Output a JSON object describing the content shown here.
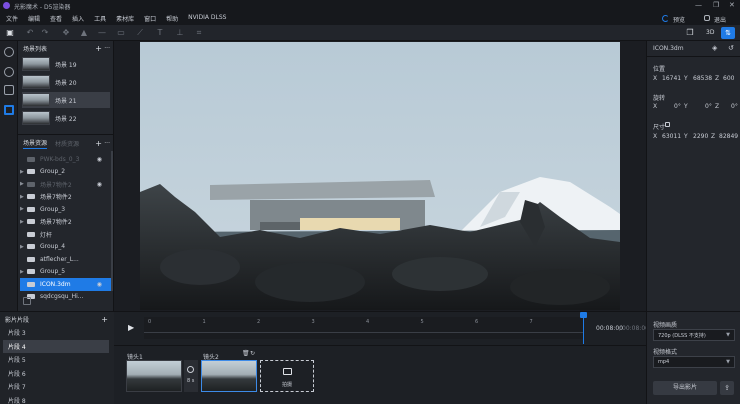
{
  "app": {
    "title": "光影魔术 - D5渲染器",
    "window_controls": [
      "—",
      "❐",
      "✕"
    ]
  },
  "menu": [
    "文件",
    "编辑",
    "查看",
    "插入",
    "工具",
    "素材库",
    "窗口",
    "帮助",
    "NVIDIA DLSS"
  ],
  "header_right": {
    "preview_label": "预览",
    "user_label": "退出"
  },
  "toolbar_right": {
    "mode_3d": "3D"
  },
  "scene_list": {
    "title": "场景列表",
    "items": [
      {
        "label": "场景 19",
        "selected": false
      },
      {
        "label": "场景 20",
        "selected": false
      },
      {
        "label": "场景 21",
        "selected": true
      },
      {
        "label": "场景 22",
        "selected": false
      }
    ]
  },
  "scene_assets": {
    "title": "场景资源",
    "tab2": "材质资源",
    "items": [
      {
        "label": "PWK-bds_0_3",
        "dim": true,
        "arrow": false,
        "eye": true,
        "sel": false
      },
      {
        "label": "Group_2",
        "dim": false,
        "arrow": true,
        "eye": false,
        "sel": false
      },
      {
        "label": "场景7物件2",
        "dim": true,
        "arrow": true,
        "eye": true,
        "sel": false
      },
      {
        "label": "场景7物件2",
        "dim": false,
        "arrow": true,
        "eye": false,
        "sel": false
      },
      {
        "label": "Group_3",
        "dim": false,
        "arrow": true,
        "eye": false,
        "sel": false
      },
      {
        "label": "场景7物件2",
        "dim": false,
        "arrow": true,
        "eye": false,
        "sel": false
      },
      {
        "label": "灯杆",
        "dim": false,
        "arrow": false,
        "eye": false,
        "sel": false
      },
      {
        "label": "Group_4",
        "dim": false,
        "arrow": true,
        "eye": false,
        "sel": false
      },
      {
        "label": "atflecher_L...",
        "dim": false,
        "arrow": false,
        "eye": false,
        "sel": false
      },
      {
        "label": "Group_5",
        "dim": false,
        "arrow": true,
        "eye": false,
        "sel": false
      },
      {
        "label": "ICON.3dm",
        "dim": false,
        "arrow": false,
        "eye": true,
        "sel": true
      },
      {
        "label": "sqdcgsqu_Hi...",
        "dim": false,
        "arrow": false,
        "eye": false,
        "sel": false
      }
    ]
  },
  "clips": {
    "title": "影片片段",
    "items": [
      {
        "label": "片段 3",
        "selected": false
      },
      {
        "label": "片段 4",
        "selected": true
      },
      {
        "label": "片段 5",
        "selected": false
      },
      {
        "label": "片段 6",
        "selected": false
      },
      {
        "label": "片段 7",
        "selected": false
      },
      {
        "label": "片段 8",
        "selected": false
      }
    ]
  },
  "timeline": {
    "ticks": [
      "0",
      "1",
      "2",
      "3",
      "4",
      "5",
      "6",
      "7"
    ],
    "current_time": "00:08:00",
    "total_time": "00:08:00",
    "shot1_label": "镜头1",
    "shot2_label": "镜头2",
    "duration_label": "8 s",
    "capture_label": "拍摄"
  },
  "properties": {
    "object_name": "ICON.3dm",
    "position_label": "位置",
    "position": {
      "x": "16741",
      "y": "68538",
      "z": "600"
    },
    "rotation_label": "旋转",
    "rotation": {
      "x": "0°",
      "y": "0°",
      "z": "0°"
    },
    "size_label": "尺寸",
    "size": {
      "x": "63011",
      "y": "2290",
      "z": "82849"
    },
    "video_quality_label": "视频画质",
    "video_quality_value": "720p (DLSS 不支持)",
    "video_format_label": "视频格式",
    "video_format_value": "mp4",
    "export_label": "导出影片"
  },
  "colors": {
    "accent": "#1f7be6",
    "panel": "#23262c",
    "bg": "#1b1d22"
  }
}
